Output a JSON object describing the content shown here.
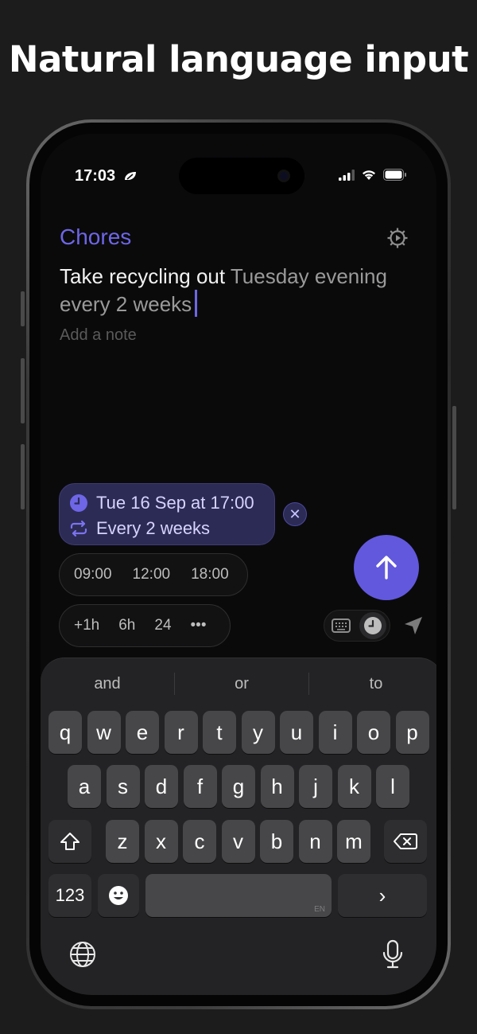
{
  "headline": "Natural language input",
  "status": {
    "time": "17:03"
  },
  "task": {
    "list_name": "Chores",
    "title_main": "Take recycling out",
    "title_parsed": "Tuesday evening every 2 weeks",
    "note_placeholder": "Add a note"
  },
  "date_chip": {
    "date": "Tue 16 Sep at 17:00",
    "repeat": "Every 2 weeks",
    "close": "✕"
  },
  "quick_times": [
    "09:00",
    "12:00",
    "18:00"
  ],
  "quick_offsets": [
    "+1h",
    "6h",
    "24",
    "•••"
  ],
  "keyboard": {
    "suggestions": [
      "and",
      "or",
      "to"
    ],
    "row1": [
      "q",
      "w",
      "e",
      "r",
      "t",
      "y",
      "u",
      "i",
      "o",
      "p"
    ],
    "row2": [
      "a",
      "s",
      "d",
      "f",
      "g",
      "h",
      "j",
      "k",
      "l"
    ],
    "row3": [
      "z",
      "x",
      "c",
      "v",
      "b",
      "n",
      "m"
    ],
    "numbers_key": "123",
    "space_lang": "EN",
    "return_key": "›"
  },
  "colors": {
    "accent": "#6258dd",
    "accent_text": "#6e66e6"
  }
}
